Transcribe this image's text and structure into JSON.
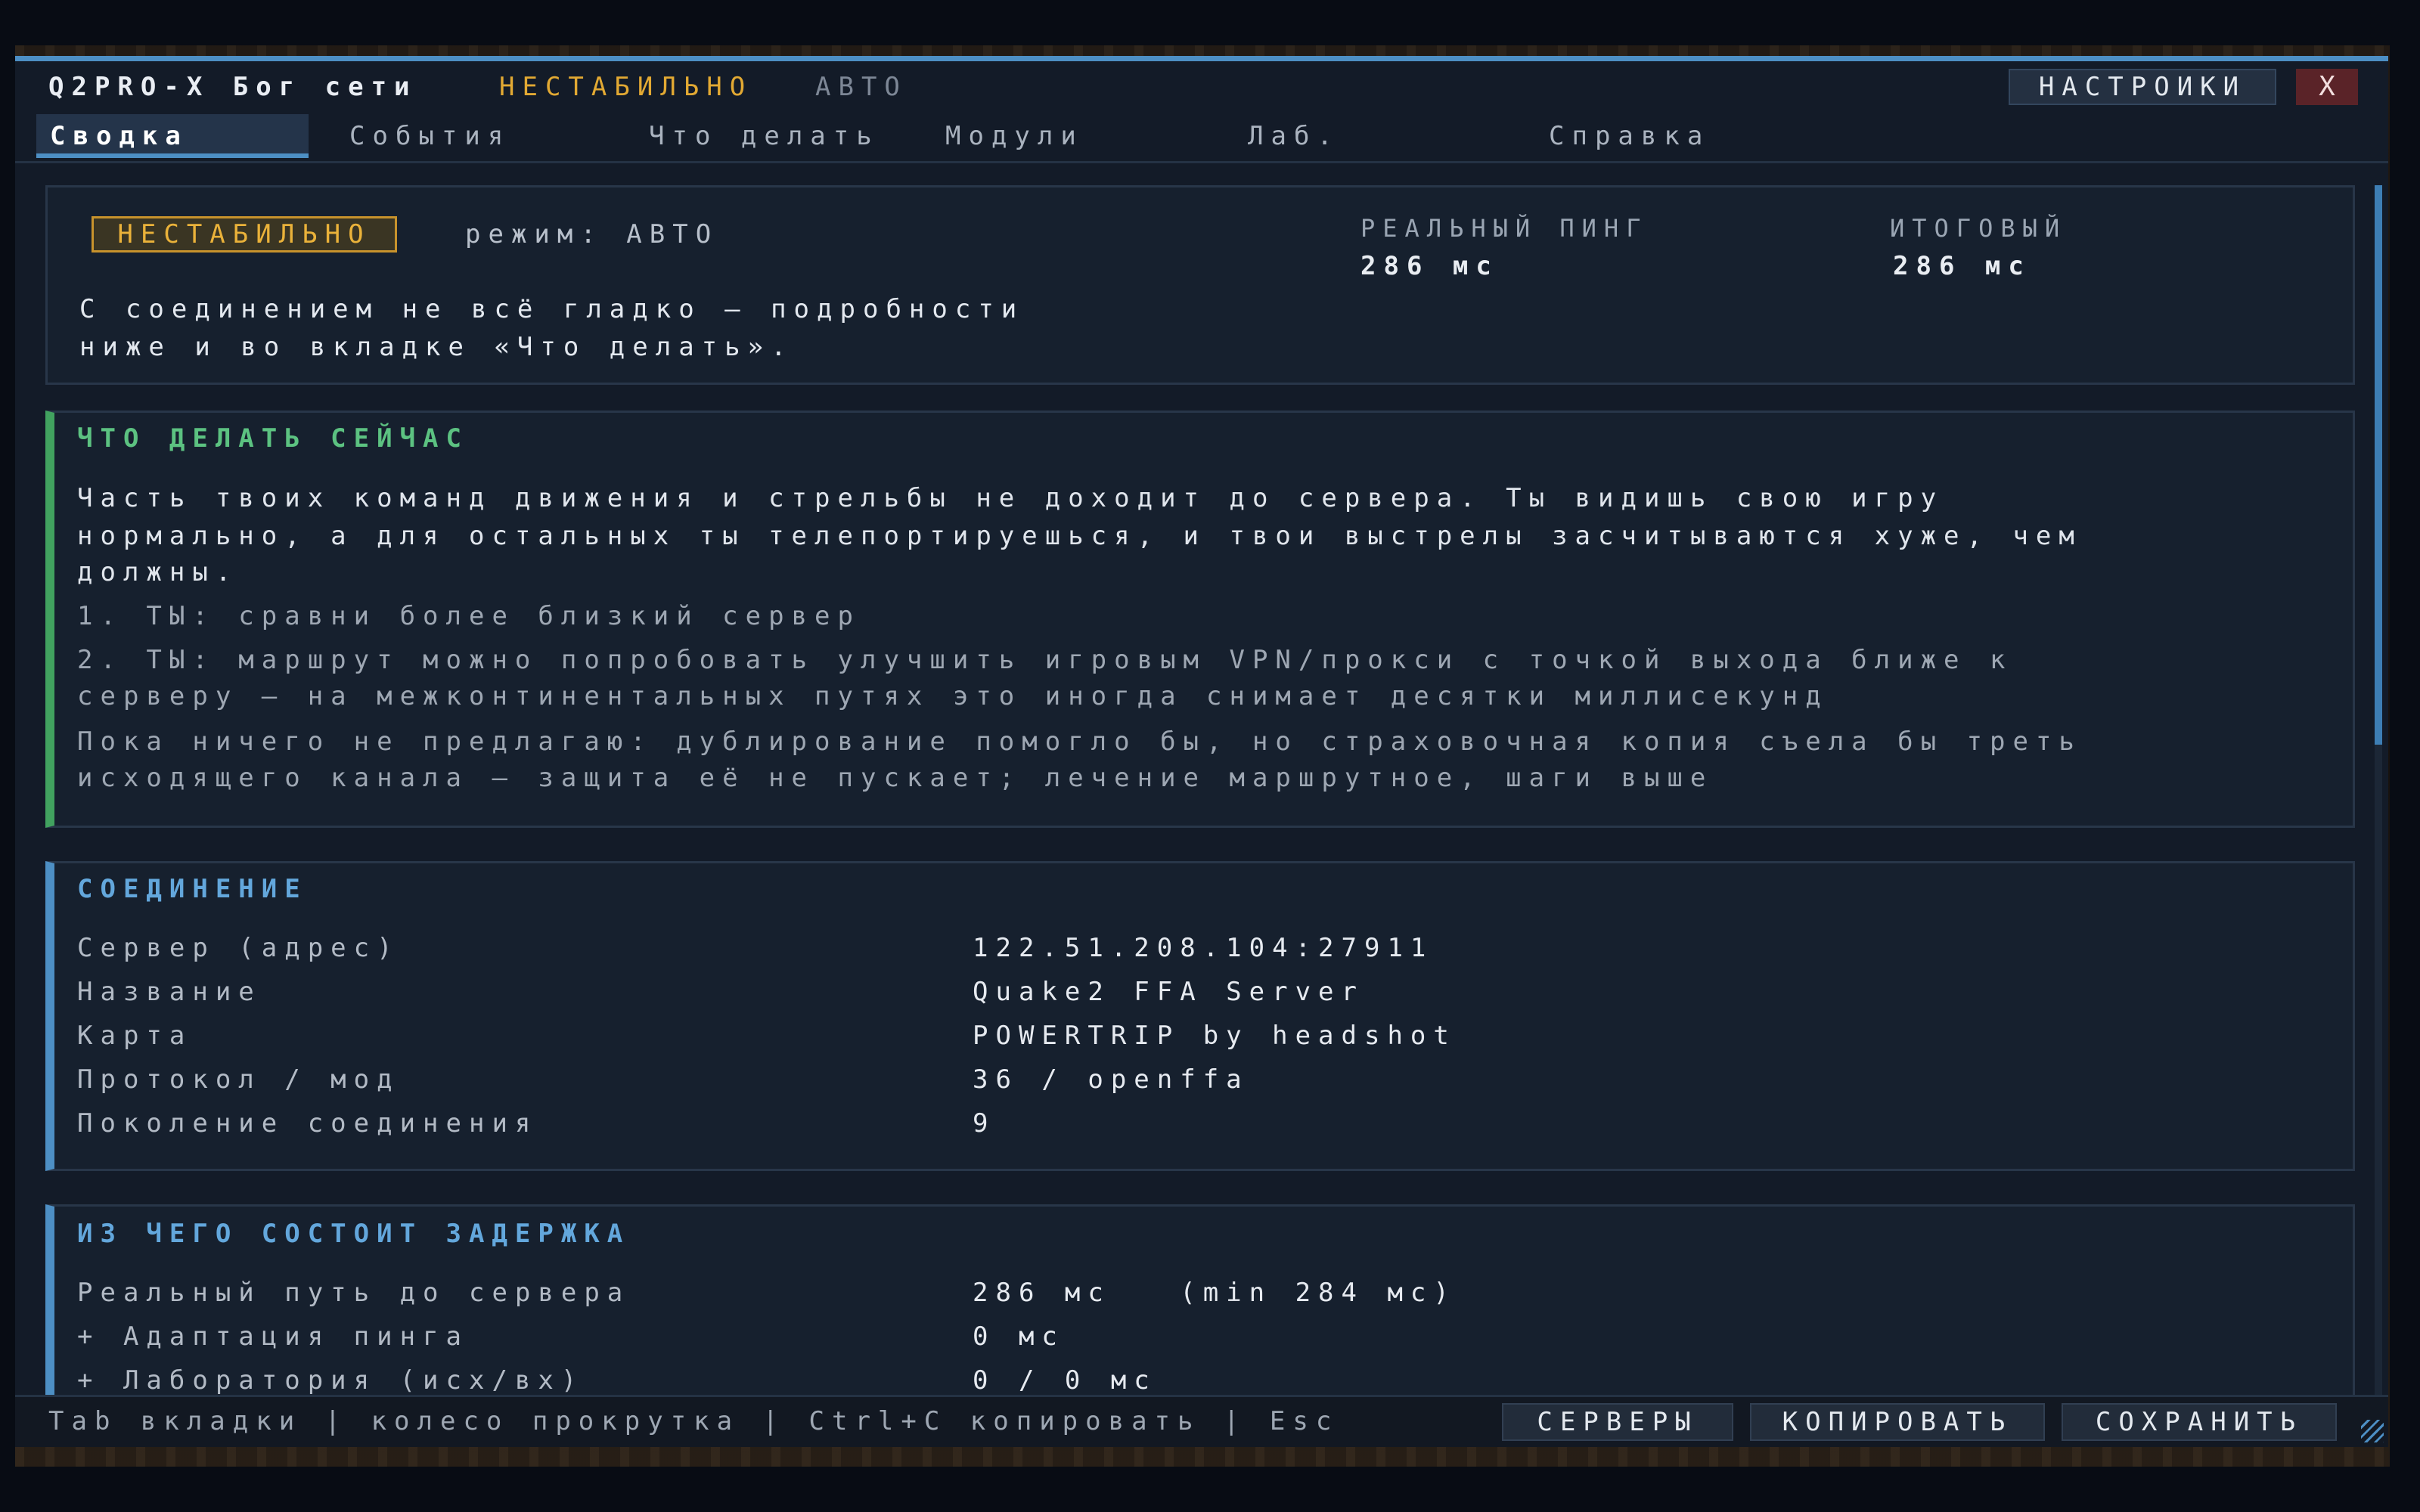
{
  "window": {
    "app_title": "Q2PRO-X Бог сети",
    "status": "НЕСТАБИЛЬНО",
    "mode": "АВТО",
    "settings_button": "НАСТРОИКИ",
    "close_button": "X"
  },
  "tabs": [
    {
      "label": "Сводка",
      "active": true
    },
    {
      "label": "События",
      "active": false
    },
    {
      "label": "Что делать",
      "active": false
    },
    {
      "label": "Модули",
      "active": false
    },
    {
      "label": "Лаб.",
      "active": false
    },
    {
      "label": "Справка",
      "active": false
    }
  ],
  "summary": {
    "badge": "НЕСТАБИЛЬНО",
    "mode_label": "режим: АВТО",
    "message_line1": "С соединением не всё гладко — подробности",
    "message_line2": "ниже и во вкладке «Что делать».",
    "real_ping_label": "РЕАЛЬНЫЙ ПИНГ",
    "real_ping_value": "286 мс",
    "total_label": "ИТОГОВЫЙ",
    "total_value": "286 мс"
  },
  "what_to_do": {
    "heading": "ЧТО ДЕЛАТЬ СЕЙЧАС",
    "p1_line1": "Часть твоих команд движения и стрельбы не доходит до сервера. Ты видишь свою игру",
    "p1_line2": "нормально, а для остальных ты телепортируешься, и твои выстрелы засчитываются хуже, чем",
    "p1_line3": "должны.",
    "item1": "1. ТЫ: сравни более близкий сервер",
    "item2_line1": "2. ТЫ: маршрут можно попробовать улучшить игровым VPN/прокси с точкой выхода ближе к",
    "item2_line2": "серверу — на межконтинентальных путях это иногда снимает десятки миллисекунд",
    "note_line1": "Пока ничего не предлагаю: дублирование помогло бы, но страховочная копия съела бы треть",
    "note_line2": "исходящего канала — защита её не пускает; лечение маршрутное, шаги выше"
  },
  "connection": {
    "heading": "СОЕДИНЕНИЕ",
    "rows": [
      {
        "label": "Сервер (адрес)",
        "value": "122.51.208.104:27911"
      },
      {
        "label": "Название",
        "value": "Quake2 FFA Server"
      },
      {
        "label": "Карта",
        "value": "POWERTRIP by headshot"
      },
      {
        "label": "Протокол / мод",
        "value": "36 / openffa"
      },
      {
        "label": "Поколение соединения",
        "value": "9"
      }
    ]
  },
  "latency": {
    "heading": "ИЗ ЧЕГО СОСТОИТ ЗАДЕРЖКА",
    "rows": [
      {
        "label": "Реальный путь до сервера",
        "value": "286 мс   (min 284 мс)"
      },
      {
        "label": "+ Адаптация пинга",
        "value": "0 мс"
      },
      {
        "label": "+ Лаборатория (исх/вх)",
        "value": "0 / 0 мс"
      }
    ]
  },
  "footer": {
    "hint": "Tab вкладки | колесо прокрутка | Ctrl+C копировать | Esc",
    "servers_button": "СЕРВЕРЫ",
    "copy_button": "КОПИРОВАТЬ",
    "save_button": "СОХРАНИТЬ"
  },
  "colors": {
    "accent": "#4d8fc4",
    "warning": "#e2a933",
    "ok_green": "#5cc281",
    "background": "#131b28"
  }
}
